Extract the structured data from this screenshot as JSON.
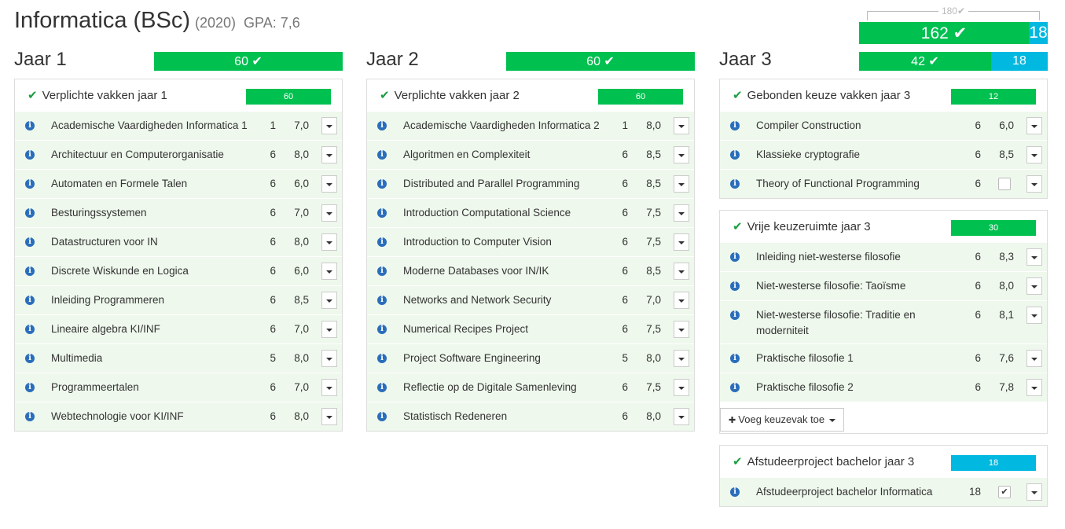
{
  "header": {
    "title": "Informatica (BSc)",
    "year": "(2020)",
    "gpa": "GPA: 7,6"
  },
  "total": {
    "required": "180✔",
    "completed": "162 ✔",
    "in_progress": "18",
    "completed_ratio": 0.9,
    "in_progress_ratio": 0.1
  },
  "colors": {
    "completed": "#00c050",
    "in_progress": "#00b8e0",
    "check": "#1a9e3f",
    "info": "#2a6ebb"
  },
  "icons": {
    "check": "check-icon",
    "info": "info-icon",
    "dropdown": "caret-down-icon",
    "plus": "plus-icon"
  },
  "columns": [
    {
      "title": "Jaar 1",
      "bar": {
        "completed": "60 ✔",
        "in_progress": "",
        "completed_ratio": 1.0
      },
      "panels": [
        {
          "title": "Verplichte vakken jaar 1",
          "bar": {
            "completed": "60",
            "in_progress": ""
          },
          "courses": [
            {
              "name": "Academische Vaardigheden Informatica 1",
              "ec": "1",
              "grade": "7,0"
            },
            {
              "name": "Architectuur en Computerorganisatie",
              "ec": "6",
              "grade": "8,0"
            },
            {
              "name": "Automaten en Formele Talen",
              "ec": "6",
              "grade": "6,0"
            },
            {
              "name": "Besturingssystemen",
              "ec": "6",
              "grade": "7,0"
            },
            {
              "name": "Datastructuren voor IN",
              "ec": "6",
              "grade": "8,0"
            },
            {
              "name": "Discrete Wiskunde en Logica",
              "ec": "6",
              "grade": "6,0"
            },
            {
              "name": "Inleiding Programmeren",
              "ec": "6",
              "grade": "8,5"
            },
            {
              "name": "Lineaire algebra KI/INF",
              "ec": "6",
              "grade": "7,0"
            },
            {
              "name": "Multimedia",
              "ec": "5",
              "grade": "8,0"
            },
            {
              "name": "Programmeertalen",
              "ec": "6",
              "grade": "7,0"
            },
            {
              "name": "Webtechnologie voor KI/INF",
              "ec": "6",
              "grade": "8,0"
            }
          ]
        }
      ]
    },
    {
      "title": "Jaar 2",
      "bar": {
        "completed": "60 ✔",
        "in_progress": "",
        "completed_ratio": 1.0
      },
      "panels": [
        {
          "title": "Verplichte vakken jaar 2",
          "bar": {
            "completed": "60",
            "in_progress": ""
          },
          "courses": [
            {
              "name": "Academische Vaardigheden Informatica 2",
              "ec": "1",
              "grade": "8,0"
            },
            {
              "name": "Algoritmen en Complexiteit",
              "ec": "6",
              "grade": "8,5"
            },
            {
              "name": "Distributed and Parallel Programming",
              "ec": "6",
              "grade": "8,5"
            },
            {
              "name": "Introduction Computational Science",
              "ec": "6",
              "grade": "7,5"
            },
            {
              "name": "Introduction to Computer Vision",
              "ec": "6",
              "grade": "7,5"
            },
            {
              "name": "Moderne Databases voor IN/IK",
              "ec": "6",
              "grade": "8,5"
            },
            {
              "name": "Networks and Network Security",
              "ec": "6",
              "grade": "7,0"
            },
            {
              "name": "Numerical Recipes Project",
              "ec": "6",
              "grade": "7,5"
            },
            {
              "name": "Project Software Engineering",
              "ec": "5",
              "grade": "8,0"
            },
            {
              "name": "Reflectie op de Digitale Samenleving",
              "ec": "6",
              "grade": "7,5"
            },
            {
              "name": "Statistisch Redeneren",
              "ec": "6",
              "grade": "8,0"
            }
          ]
        }
      ]
    },
    {
      "title": "Jaar 3",
      "bar": {
        "completed": "42 ✔",
        "in_progress": "18",
        "completed_ratio": 0.7
      },
      "panels": [
        {
          "title": "Gebonden keuze vakken jaar 3",
          "bar": {
            "completed": "12",
            "in_progress": ""
          },
          "courses": [
            {
              "name": "Compiler Construction",
              "ec": "6",
              "grade": "6,0"
            },
            {
              "name": "Klassieke cryptografie",
              "ec": "6",
              "grade": "8,5"
            },
            {
              "name": "Theory of Functional Programming",
              "ec": "6",
              "grade": "",
              "checkbox": ""
            }
          ]
        },
        {
          "title": "Vrije keuzeruimte jaar 3",
          "bar": {
            "completed": "30",
            "in_progress": ""
          },
          "courses": [
            {
              "name": "Inleiding niet-westerse filosofie",
              "ec": "6",
              "grade": "8,3"
            },
            {
              "name": "Niet-westerse filosofie: Taoïsme",
              "ec": "6",
              "grade": "8,0"
            },
            {
              "name": "Niet-westerse filosofie: Traditie en moderniteit",
              "ec": "6",
              "grade": "8,1"
            },
            {
              "name": "Praktische filosofie 1",
              "ec": "6",
              "grade": "7,6"
            },
            {
              "name": "Praktische filosofie 2",
              "ec": "6",
              "grade": "7,8"
            }
          ],
          "add_button": "Voeg keuzevak toe"
        },
        {
          "title": "Afstudeerproject bachelor jaar 3",
          "bar": {
            "completed": "",
            "in_progress": "18"
          },
          "courses": [
            {
              "name": "Afstudeerproject bachelor Informatica",
              "ec": "18",
              "grade": "",
              "checkbox": "✔"
            }
          ]
        }
      ]
    }
  ]
}
